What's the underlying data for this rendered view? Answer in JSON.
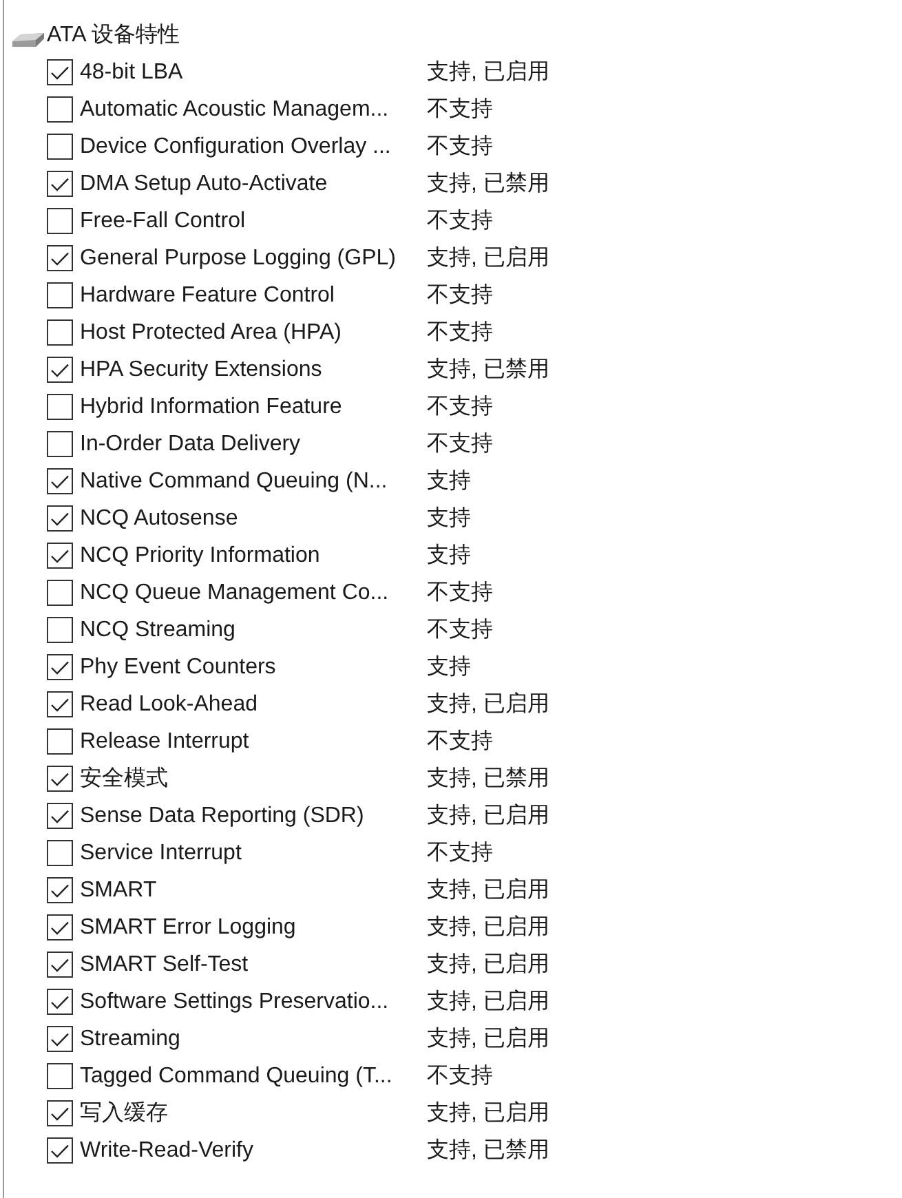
{
  "section": {
    "title": "ATA 设备特性",
    "features": [
      {
        "name": "48-bit LBA",
        "checked": true,
        "status": "支持, 已启用"
      },
      {
        "name": "Automatic Acoustic Managem...",
        "checked": false,
        "status": "不支持"
      },
      {
        "name": "Device Configuration Overlay ...",
        "checked": false,
        "status": "不支持"
      },
      {
        "name": "DMA Setup Auto-Activate",
        "checked": true,
        "status": "支持, 已禁用"
      },
      {
        "name": "Free-Fall Control",
        "checked": false,
        "status": "不支持"
      },
      {
        "name": "General Purpose Logging (GPL)",
        "checked": true,
        "status": "支持, 已启用"
      },
      {
        "name": "Hardware Feature Control",
        "checked": false,
        "status": "不支持"
      },
      {
        "name": "Host Protected Area (HPA)",
        "checked": false,
        "status": "不支持"
      },
      {
        "name": "HPA Security Extensions",
        "checked": true,
        "status": "支持, 已禁用"
      },
      {
        "name": "Hybrid Information Feature",
        "checked": false,
        "status": "不支持"
      },
      {
        "name": "In-Order Data Delivery",
        "checked": false,
        "status": "不支持"
      },
      {
        "name": "Native Command Queuing (N...",
        "checked": true,
        "status": "支持"
      },
      {
        "name": "NCQ Autosense",
        "checked": true,
        "status": "支持"
      },
      {
        "name": "NCQ Priority Information",
        "checked": true,
        "status": "支持"
      },
      {
        "name": "NCQ Queue Management Co...",
        "checked": false,
        "status": "不支持"
      },
      {
        "name": "NCQ Streaming",
        "checked": false,
        "status": "不支持"
      },
      {
        "name": "Phy Event Counters",
        "checked": true,
        "status": "支持"
      },
      {
        "name": "Read Look-Ahead",
        "checked": true,
        "status": "支持, 已启用"
      },
      {
        "name": "Release Interrupt",
        "checked": false,
        "status": "不支持"
      },
      {
        "name": "安全模式",
        "checked": true,
        "status": "支持, 已禁用"
      },
      {
        "name": "Sense Data Reporting (SDR)",
        "checked": true,
        "status": "支持, 已启用"
      },
      {
        "name": "Service Interrupt",
        "checked": false,
        "status": "不支持"
      },
      {
        "name": "SMART",
        "checked": true,
        "status": "支持, 已启用"
      },
      {
        "name": "SMART Error Logging",
        "checked": true,
        "status": "支持, 已启用"
      },
      {
        "name": "SMART Self-Test",
        "checked": true,
        "status": "支持, 已启用"
      },
      {
        "name": "Software Settings Preservatio...",
        "checked": true,
        "status": "支持, 已启用"
      },
      {
        "name": "Streaming",
        "checked": true,
        "status": "支持, 已启用"
      },
      {
        "name": "Tagged Command Queuing (T...",
        "checked": false,
        "status": "不支持"
      },
      {
        "name": "写入缓存",
        "checked": true,
        "status": "支持, 已启用"
      },
      {
        "name": "Write-Read-Verify",
        "checked": true,
        "status": "支持, 已禁用"
      }
    ]
  }
}
